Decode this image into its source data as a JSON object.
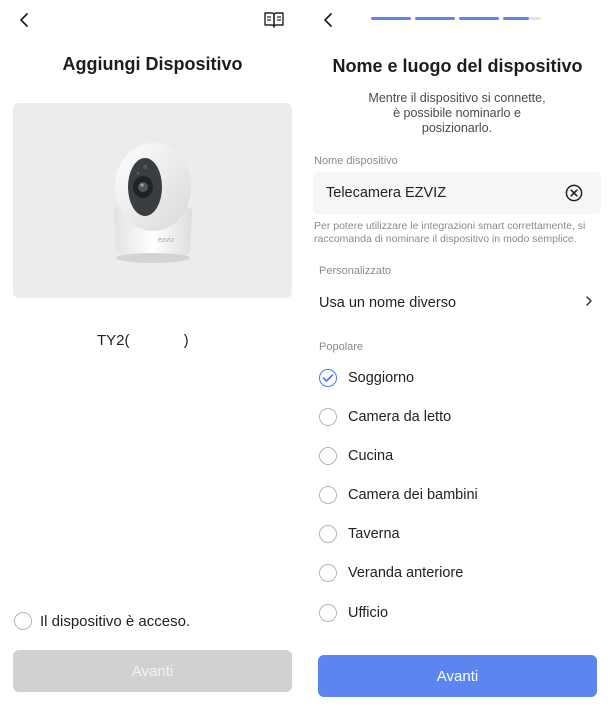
{
  "left": {
    "title": "Aggiungi Dispositivo",
    "model": "TY2(             )",
    "camera_brand": "ezviz",
    "confirm_label": "Il dispositivo è acceso.",
    "confirm_checked": false,
    "next_label": "Avanti",
    "next_enabled": false,
    "icons": {
      "back": "chevron-left-icon",
      "guide": "book-icon"
    }
  },
  "right": {
    "progress": {
      "total_steps": 4,
      "completed_steps": 3,
      "current_step_fill": 0.6
    },
    "title": "Nome e luogo del dispositivo",
    "description": "Mentre il dispositivo si connette, è possibile nominarlo e posizionarlo.",
    "name_field": {
      "label": "Nome dispositivo",
      "value": "Telecamera EZVIZ"
    },
    "hint": "Per potere utilizzare le integrazioni smart correttamente, si raccomanda di nominare il dispositivo in modo semplice.",
    "custom_section": {
      "label": "Personalizzato",
      "item_label": "Usa un nome diverso"
    },
    "popular_section": {
      "label": "Popolare",
      "options": [
        {
          "label": "Soggiorno",
          "selected": true
        },
        {
          "label": "Camera da letto",
          "selected": false
        },
        {
          "label": "Cucina",
          "selected": false
        },
        {
          "label": "Camera dei bambini",
          "selected": false
        },
        {
          "label": "Taverna",
          "selected": false
        },
        {
          "label": "Veranda anteriore",
          "selected": false
        },
        {
          "label": "Ufficio",
          "selected": false
        }
      ]
    },
    "next_label": "Avanti",
    "next_enabled": true
  },
  "colors": {
    "accent": "#5b86f0",
    "disabled_button": "#d1d1d1",
    "card_background": "#ececec",
    "field_background": "#f6f6f6",
    "muted_text": "#8a8a8a"
  }
}
